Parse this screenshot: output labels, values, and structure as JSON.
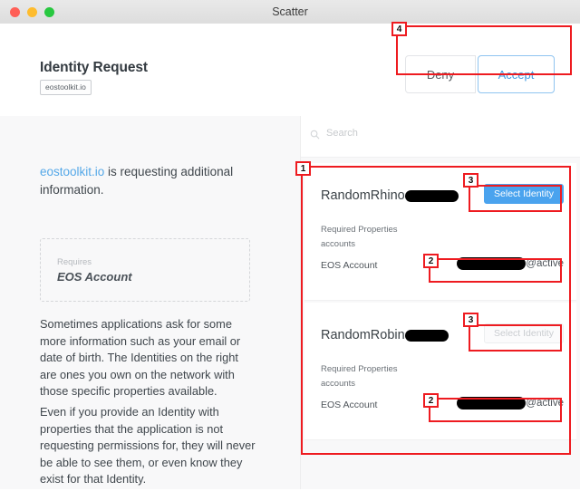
{
  "window": {
    "title": "Scatter",
    "controls": [
      "close",
      "minimize",
      "zoom"
    ]
  },
  "header": {
    "request_title": "Identity Request",
    "origin": "eostoolkit.io",
    "deny_label": "Deny",
    "accept_label": "Accept"
  },
  "left_panel": {
    "lede_brand": "eostoolkit.io",
    "lede_rest": " is requesting additional information.",
    "requires_label": "Requires",
    "requires_value": "EOS Account",
    "paragraph_1": "Sometimes applications ask for some more information such as your email or date of birth. The Identities on the right are ones you own on the network with those specific properties available.",
    "paragraph_2": "Even if you provide an Identity with properties that the application is not requesting permissions for, they will never be able to see them, or even know they exist for that Identity."
  },
  "right_panel": {
    "search": {
      "placeholder": "Search",
      "value": "",
      "icon": "search-icon"
    },
    "identities": [
      {
        "name_visible": "RandomRhino",
        "name_redacted": true,
        "select_label": "Select Identity",
        "select_state": "enabled",
        "required_properties_label": "Required Properties",
        "properties_group": "accounts",
        "account_row_label": "EOS Account",
        "account_value_redacted": true,
        "account_permission": "@active"
      },
      {
        "name_visible": "RandomRobin",
        "name_redacted": true,
        "select_label": "Select Identity",
        "select_state": "disabled",
        "required_properties_label": "Required Properties",
        "properties_group": "accounts",
        "account_row_label": "EOS Account",
        "account_value_redacted": true,
        "account_permission": "@active"
      }
    ]
  },
  "annotations": [
    {
      "number": "1",
      "target": "identity-list-region"
    },
    {
      "number": "2",
      "target": "eos-account-value-card-1"
    },
    {
      "number": "3",
      "target": "select-identity-button-card-1"
    },
    {
      "number": "2",
      "target": "eos-account-value-card-2"
    },
    {
      "number": "3",
      "target": "select-identity-button-card-2"
    },
    {
      "number": "4",
      "target": "deny-accept-actions"
    }
  ],
  "colors": {
    "accent_blue": "#4aa3ee",
    "link_blue": "#55a8e8",
    "annotation_red": "#ee1b20",
    "panel_bg": "#f8f8f9",
    "card_bg": "#ffffff"
  }
}
